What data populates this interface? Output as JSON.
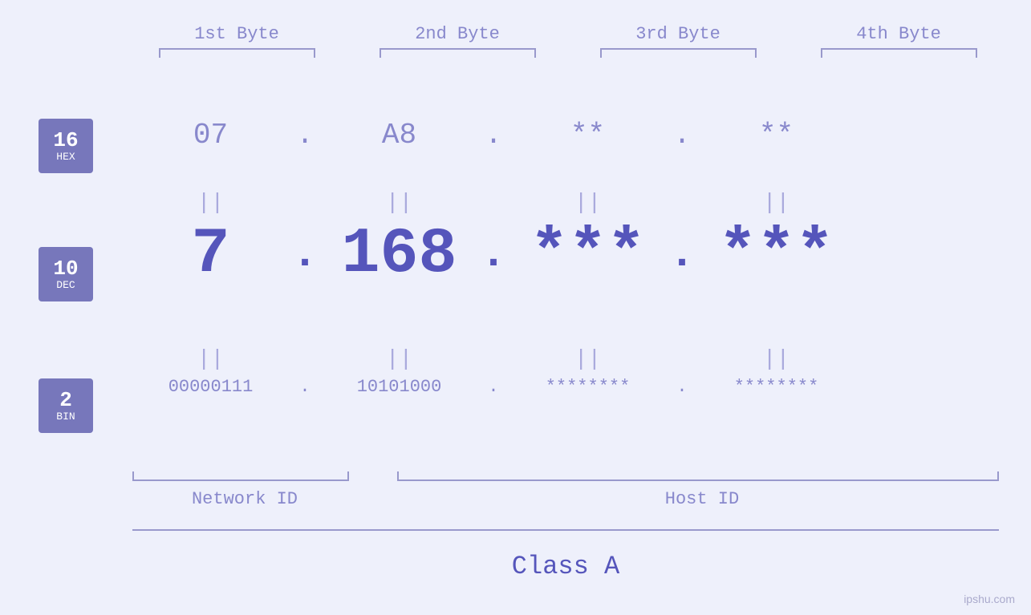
{
  "page": {
    "background": "#eef0fb",
    "watermark": "ipshu.com"
  },
  "byte_labels": [
    "1st Byte",
    "2nd Byte",
    "3rd Byte",
    "4th Byte"
  ],
  "bases": [
    {
      "number": "16",
      "text": "HEX"
    },
    {
      "number": "10",
      "text": "DEC"
    },
    {
      "number": "2",
      "text": "BIN"
    }
  ],
  "hex_row": {
    "values": [
      "07",
      "A8",
      "**",
      "**"
    ],
    "dots": [
      ".",
      ".",
      ".",
      ""
    ]
  },
  "dec_row": {
    "values": [
      "7",
      "168",
      "***",
      "***"
    ],
    "dots": [
      ".",
      ".",
      ".",
      ""
    ]
  },
  "bin_row": {
    "values": [
      "00000111",
      "10101000",
      "********",
      "********"
    ],
    "dots": [
      ".",
      ".",
      ".",
      ""
    ]
  },
  "labels": {
    "network_id": "Network ID",
    "host_id": "Host ID",
    "class": "Class A"
  },
  "equals_symbol": "||"
}
